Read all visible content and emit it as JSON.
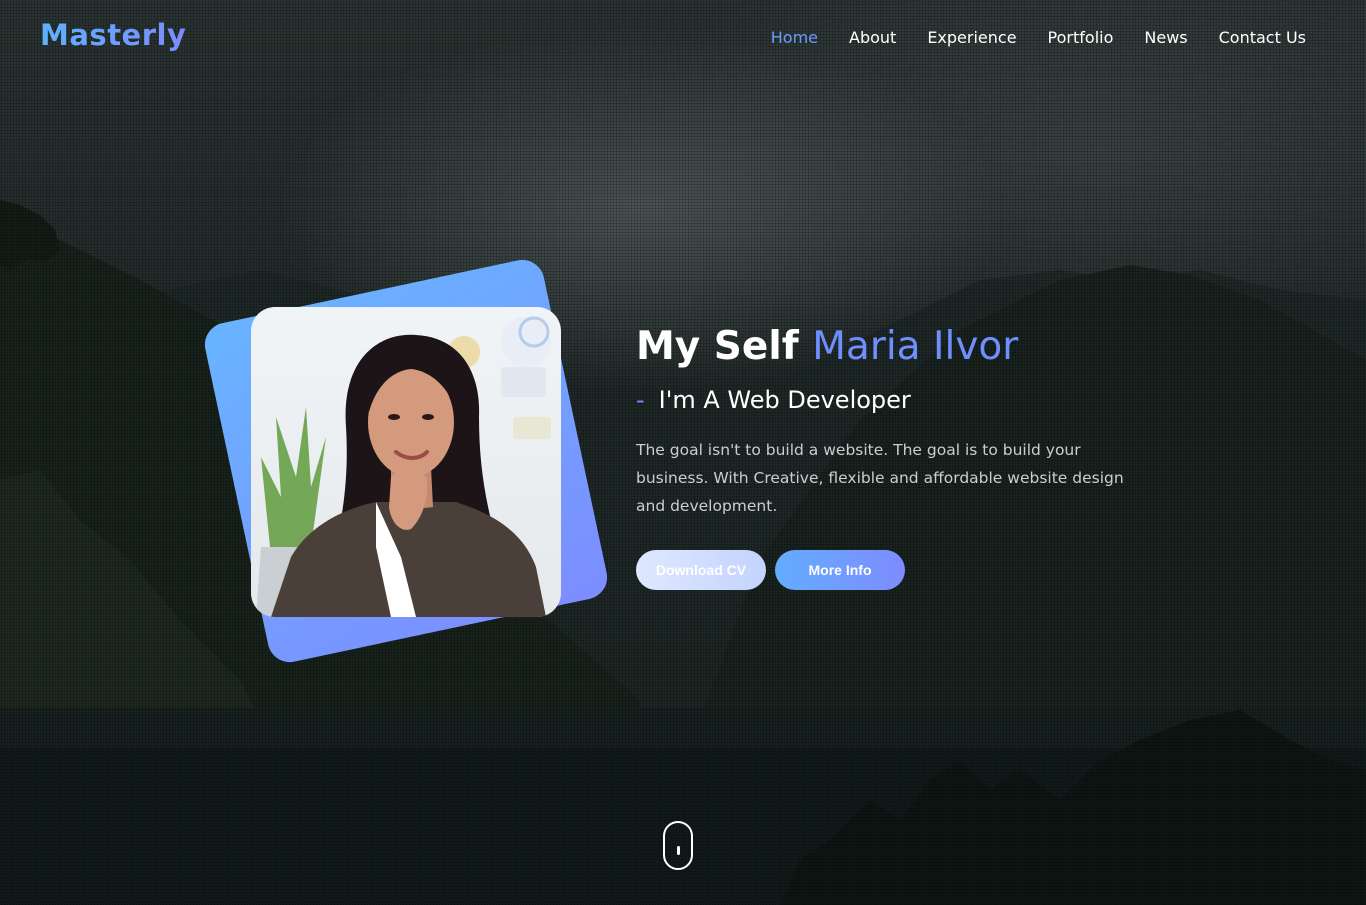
{
  "brand": {
    "logo_text": "Masterly"
  },
  "nav": {
    "items": [
      {
        "label": "Home",
        "active": true
      },
      {
        "label": "About",
        "active": false
      },
      {
        "label": "Experience",
        "active": false
      },
      {
        "label": "Portfolio",
        "active": false
      },
      {
        "label": "News",
        "active": false
      },
      {
        "label": "Contact Us",
        "active": false
      }
    ]
  },
  "hero": {
    "title_prefix": "My Self",
    "title_name": "Maria Ilvor",
    "subtitle_dash": "-",
    "subtitle": "I'm A Web Developer",
    "description": "The goal isn't to build a website. The goal is to build your business. With Creative, flexible and affordable website design and development.",
    "download_button": "Download CV",
    "info_button": "More Info"
  },
  "colors": {
    "accent": "#6f8fff",
    "accent_light": "#62adff",
    "nav_active": "#6a9cff"
  },
  "icons": {
    "scroll_indicator": "mouse-scroll-icon"
  }
}
